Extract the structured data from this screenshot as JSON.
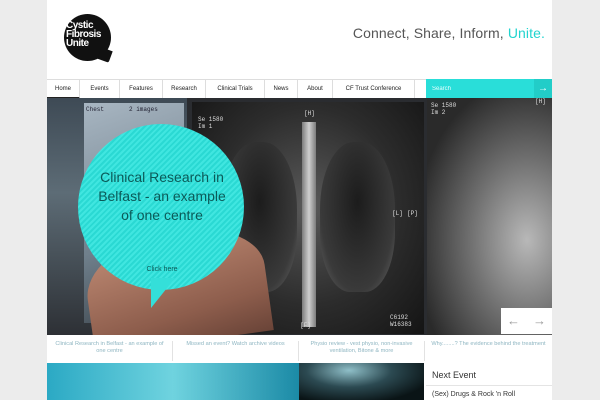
{
  "logo": {
    "lines": [
      "Cystic",
      "Fibrosis",
      "Unite"
    ]
  },
  "tagline": {
    "main": "Connect, Share, Inform,",
    "accent": "Unite."
  },
  "nav": {
    "items": [
      "Home",
      "Events",
      "Features",
      "Research",
      "Clinical Trials",
      "News",
      "About",
      "CF Trust Conference"
    ],
    "active": "Home"
  },
  "search": {
    "placeholder": "Search",
    "button_icon": "→"
  },
  "hero": {
    "bubble_title": "Clinical Research in Belfast - an example of one centre",
    "bubble_link": "Click here",
    "xray_labels": {
      "left_top": "Se 1580\nIm 1",
      "top_marker": "[H]",
      "right_marker": "[P]",
      "left_marker": "[L]",
      "bottom_marker": "[F]",
      "bottom_right": "C6192\nW16383",
      "right_top": "Se 1580\nIm 2",
      "right_top_marker": "[H]",
      "screen_tab": "2 images",
      "screen_label": "Chest"
    },
    "prev_icon": "←",
    "next_icon": "→"
  },
  "captions": [
    "Clinical Research in Belfast - an example of one centre",
    "Missed an event? Watch archive videos",
    "Physio review - vest physio, non-invasive ventilation, Bitone & more",
    "Why........? The evidence behind the treatment"
  ],
  "next_event": {
    "title": "Next Event",
    "item": "(Sex) Drugs & Rock 'n Roll"
  },
  "colors": {
    "accent": "#29ded9",
    "text_dark": "#222222",
    "caption_text": "#8fb6c2"
  }
}
